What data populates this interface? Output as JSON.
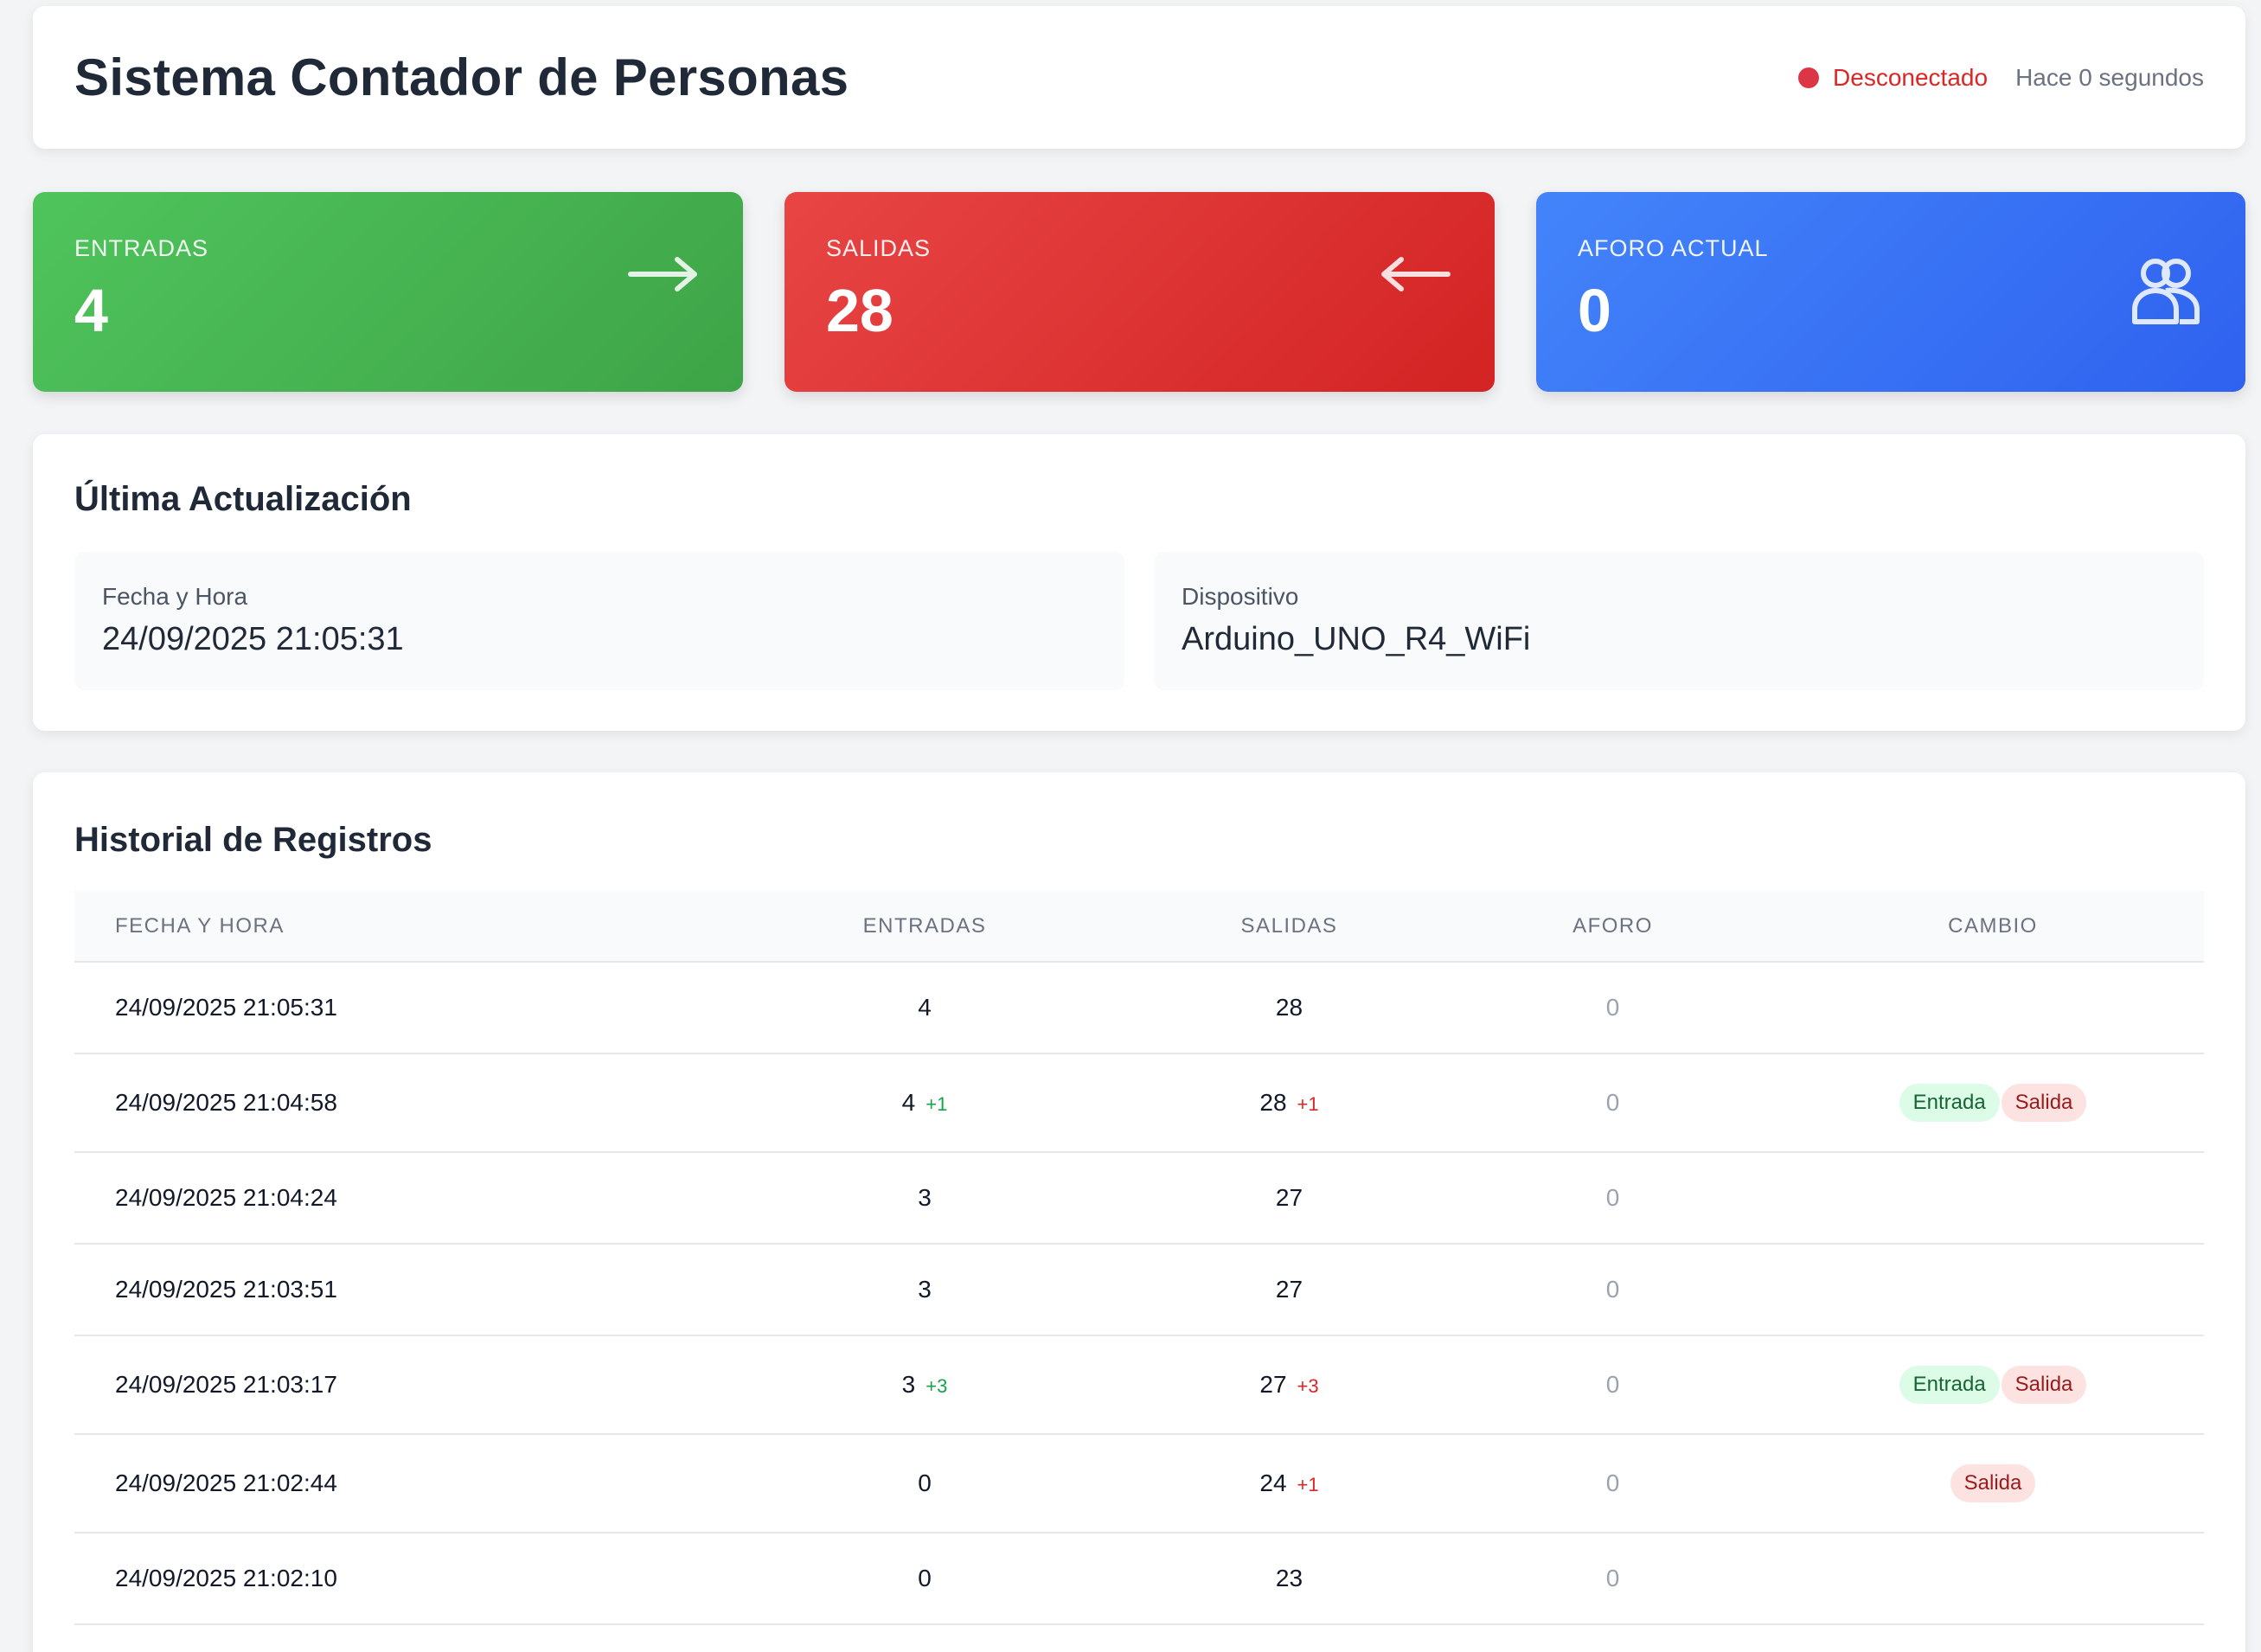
{
  "header": {
    "title": "Sistema Contador de Personas",
    "status": "Desconectado",
    "last_seen": "Hace 0 segundos",
    "status_color": "#dc3545"
  },
  "cards": {
    "entradas": {
      "label": "ENTRADAS",
      "value": "4",
      "icon": "arrow-right-icon",
      "color": "#46b451"
    },
    "salidas": {
      "label": "SALIDAS",
      "value": "28",
      "icon": "arrow-left-icon",
      "color": "#de3131"
    },
    "aforo": {
      "label": "AFORO ACTUAL",
      "value": "0",
      "icon": "users-icon",
      "color": "#3a72f5"
    }
  },
  "ultima": {
    "title": "Última Actualización",
    "fecha_label": "Fecha y Hora",
    "fecha_value": "24/09/2025 21:05:31",
    "dispositivo_label": "Dispositivo",
    "dispositivo_value": "Arduino_UNO_R4_WiFi"
  },
  "historial": {
    "title": "Historial de Registros",
    "columns": [
      "FECHA Y HORA",
      "ENTRADAS",
      "SALIDAS",
      "AFORO",
      "CAMBIO"
    ],
    "rows": [
      {
        "fecha": "24/09/2025 21:05:31",
        "entradas": "4",
        "entradas_delta": "",
        "salidas": "28",
        "salidas_delta": "",
        "aforo": "0",
        "badges": []
      },
      {
        "fecha": "24/09/2025 21:04:58",
        "entradas": "4",
        "entradas_delta": "+1",
        "salidas": "28",
        "salidas_delta": "+1",
        "aforo": "0",
        "badges": [
          "Entrada",
          "Salida"
        ]
      },
      {
        "fecha": "24/09/2025 21:04:24",
        "entradas": "3",
        "entradas_delta": "",
        "salidas": "27",
        "salidas_delta": "",
        "aforo": "0",
        "badges": []
      },
      {
        "fecha": "24/09/2025 21:03:51",
        "entradas": "3",
        "entradas_delta": "",
        "salidas": "27",
        "salidas_delta": "",
        "aforo": "0",
        "badges": []
      },
      {
        "fecha": "24/09/2025 21:03:17",
        "entradas": "3",
        "entradas_delta": "+3",
        "salidas": "27",
        "salidas_delta": "+3",
        "aforo": "0",
        "badges": [
          "Entrada",
          "Salida"
        ]
      },
      {
        "fecha": "24/09/2025 21:02:44",
        "entradas": "0",
        "entradas_delta": "",
        "salidas": "24",
        "salidas_delta": "+1",
        "aforo": "0",
        "badges": [
          "Salida"
        ]
      },
      {
        "fecha": "24/09/2025 21:02:10",
        "entradas": "0",
        "entradas_delta": "",
        "salidas": "23",
        "salidas_delta": "",
        "aforo": "0",
        "badges": []
      }
    ]
  }
}
